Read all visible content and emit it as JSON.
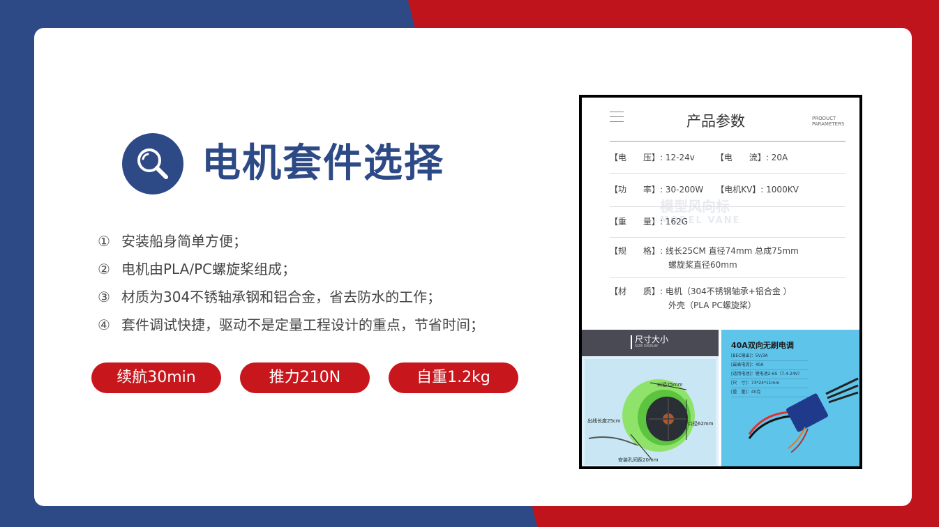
{
  "title": "电机套件选择",
  "points": [
    {
      "num": "①",
      "text": "安装船身简单方便；"
    },
    {
      "num": "②",
      "text": "电机由PLA/PC螺旋桨组成；"
    },
    {
      "num": "③",
      "text": "材质为304不锈轴承钢和铝合金，省去防水的工作；"
    },
    {
      "num": "④",
      "text": "套件调试快捷，驱动不是定量工程设计的重点，节省时间；"
    }
  ],
  "pills": [
    "续航30min",
    "推力210N",
    "自重1.2kg"
  ],
  "product": {
    "header_title": "产品参数",
    "header_sub": "PRODUCT PARAMETERS",
    "specs": [
      [
        "【电　　压】: 12-24v　　　【电　　流】: 20A"
      ],
      [
        "【功　　率】: 30-200W　　【电机KV】: 1000KV"
      ],
      [
        "【重　　量】: 162G"
      ],
      [
        "【规　　格】: 线长25CM 直径74mm 总成75mm",
        "　　　　　　　螺旋桨直径60mm"
      ],
      [
        "【材　　质】: 电机（304不锈钢轴承+铝合金 ）",
        "　　　　　　　外壳（PLA PC螺旋桨）"
      ]
    ],
    "watermark_cn": "模型风向标",
    "watermark_en": "MODEL VANE",
    "size_title": "尺寸大小",
    "size_sub": "SIZE DISPLAY",
    "dims": {
      "outer": "口径75mm",
      "inner": "口径62mm",
      "wire": "出线长度25cm",
      "hole": "安装孔间距20mm"
    },
    "esc_title": "40A双向无刷电调",
    "esc_specs": [
      "[BEC输出]：5V/3A",
      "[最高电流]：40A",
      "[适用电池]：锂电池2-6S（7.4-24V）",
      "[尺　寸]：73*24*11mm",
      "[重　量]：40克"
    ]
  },
  "colors": {
    "blue": "#2d4a86",
    "red": "#c8161d"
  }
}
